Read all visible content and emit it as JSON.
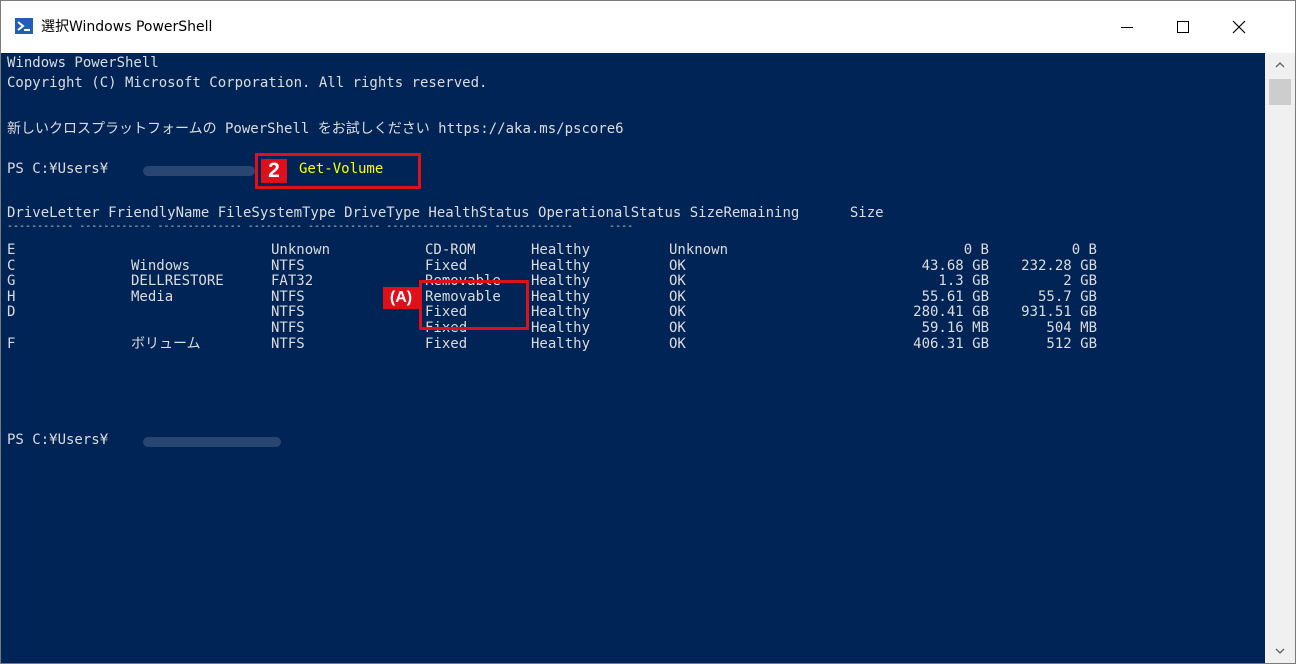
{
  "window": {
    "title": "選択Windows PowerShell",
    "minimize_glyph": "—",
    "maximize_glyph": "☐",
    "close_glyph": "✕"
  },
  "console": {
    "banner_line1": "Windows PowerShell",
    "banner_line2": "Copyright (C) Microsoft Corporation. All rights reserved.",
    "promo_line": "新しいクロスプラットフォームの PowerShell をお試しください https://aka.ms/pscore6",
    "prompt1": "PS C:¥Users¥",
    "command": "Get-Volume",
    "prompt2": "PS C:¥Users¥",
    "header": "DriveLetter FriendlyName FileSystemType DriveType HealthStatus OperationalStatus SizeRemaining      Size",
    "separator": "----------- ------------ -------------- --------- ------------ ----------------- -------------      ----",
    "columns": [
      "DriveLetter",
      "FriendlyName",
      "FileSystemType",
      "DriveType",
      "HealthStatus",
      "OperationalStatus",
      "SizeRemaining",
      "Size"
    ],
    "rows": [
      {
        "letter": "E",
        "name": "",
        "fs": "Unknown",
        "type": "CD-ROM",
        "health": "Healthy",
        "op": "Unknown",
        "remaining": "0 B",
        "size": "0 B"
      },
      {
        "letter": "C",
        "name": "Windows",
        "fs": "NTFS",
        "type": "Fixed",
        "health": "Healthy",
        "op": "OK",
        "remaining": "43.68 GB",
        "size": "232.28 GB"
      },
      {
        "letter": "G",
        "name": "DELLRESTORE",
        "fs": "FAT32",
        "type": "Removable",
        "health": "Healthy",
        "op": "OK",
        "remaining": "1.3 GB",
        "size": "2 GB"
      },
      {
        "letter": "H",
        "name": "Media",
        "fs": "NTFS",
        "type": "Removable",
        "health": "Healthy",
        "op": "OK",
        "remaining": "55.61 GB",
        "size": "55.7 GB"
      },
      {
        "letter": "D",
        "name": "",
        "fs": "NTFS",
        "type": "Fixed",
        "health": "Healthy",
        "op": "OK",
        "remaining": "280.41 GB",
        "size": "931.51 GB"
      },
      {
        "letter": "",
        "name": "",
        "fs": "NTFS",
        "type": "Fixed",
        "health": "Healthy",
        "op": "OK",
        "remaining": "59.16 MB",
        "size": "504 MB"
      },
      {
        "letter": "F",
        "name": "ボリューム",
        "fs": "NTFS",
        "type": "Fixed",
        "health": "Healthy",
        "op": "OK",
        "remaining": "406.31 GB",
        "size": "512 GB"
      }
    ]
  },
  "annotations": {
    "step_badge": "2",
    "callout_badge": "(A)",
    "highlight_color": "#e0101a"
  },
  "colors": {
    "console_bg": "#012456",
    "console_text": "#dcdcdc",
    "command_text": "#ffff00"
  }
}
